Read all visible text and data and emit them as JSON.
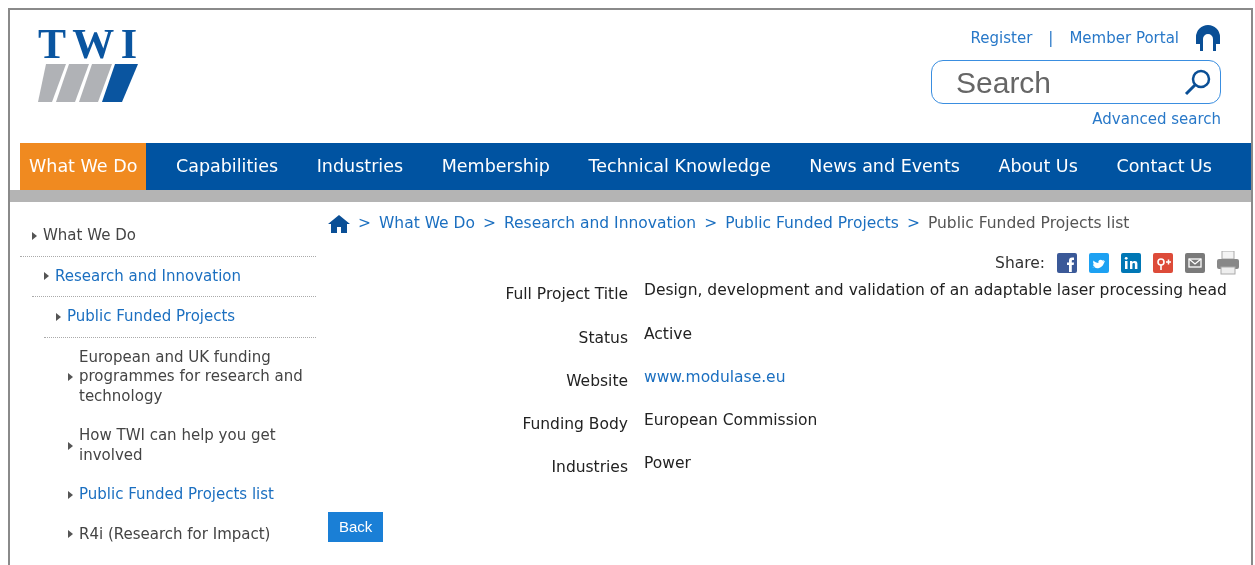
{
  "header": {
    "logo_text": "TWI",
    "links": [
      "Register",
      "|",
      "Member Portal"
    ],
    "search": {
      "placeholder": "Search"
    },
    "advanced_search": "Advanced search"
  },
  "nav": [
    {
      "label": "What We Do",
      "selected": true
    },
    {
      "label": "Capabilities",
      "selected": false
    },
    {
      "label": "Industries",
      "selected": false
    },
    {
      "label": "Membership",
      "selected": false
    },
    {
      "label": "Technical Knowledge",
      "selected": false
    },
    {
      "label": "News and Events",
      "selected": false
    },
    {
      "label": "About Us",
      "selected": false
    },
    {
      "label": "Contact Us",
      "selected": false
    }
  ],
  "sidebar": {
    "items": [
      {
        "label": "What We Do",
        "highlighted": false,
        "children": [
          {
            "label": "Research and Innovation",
            "highlighted": true,
            "children": [
              {
                "label": "Public Funded Projects",
                "highlighted": true,
                "children": [
                  {
                    "label": "European and UK funding programmes for research and technology",
                    "highlighted": false
                  },
                  {
                    "label": "How TWI can help you get involved",
                    "highlighted": false
                  },
                  {
                    "label": "Public Funded Projects list",
                    "highlighted": true
                  },
                  {
                    "label": "R4i (Research for Impact)",
                    "highlighted": false
                  }
                ]
              }
            ]
          }
        ]
      }
    ]
  },
  "breadcrumb": [
    "What We Do",
    "Research and Innovation",
    "Public Funded Projects",
    "Public Funded Projects list"
  ],
  "breadcrumb_separator": ">",
  "share_label": "Share:",
  "details": [
    {
      "label": "Full Project Title",
      "value": "Design, development and validation of an adaptable laser processing head",
      "kind": "text"
    },
    {
      "label": "Status",
      "value": "Active",
      "kind": "text"
    },
    {
      "label": "Website",
      "value": "www.modulase.eu",
      "kind": "link"
    },
    {
      "label": "Funding Body",
      "value": "European Commission",
      "kind": "text"
    },
    {
      "label": "Industries",
      "value": "Power",
      "kind": "text"
    }
  ],
  "back_button": "Back"
}
